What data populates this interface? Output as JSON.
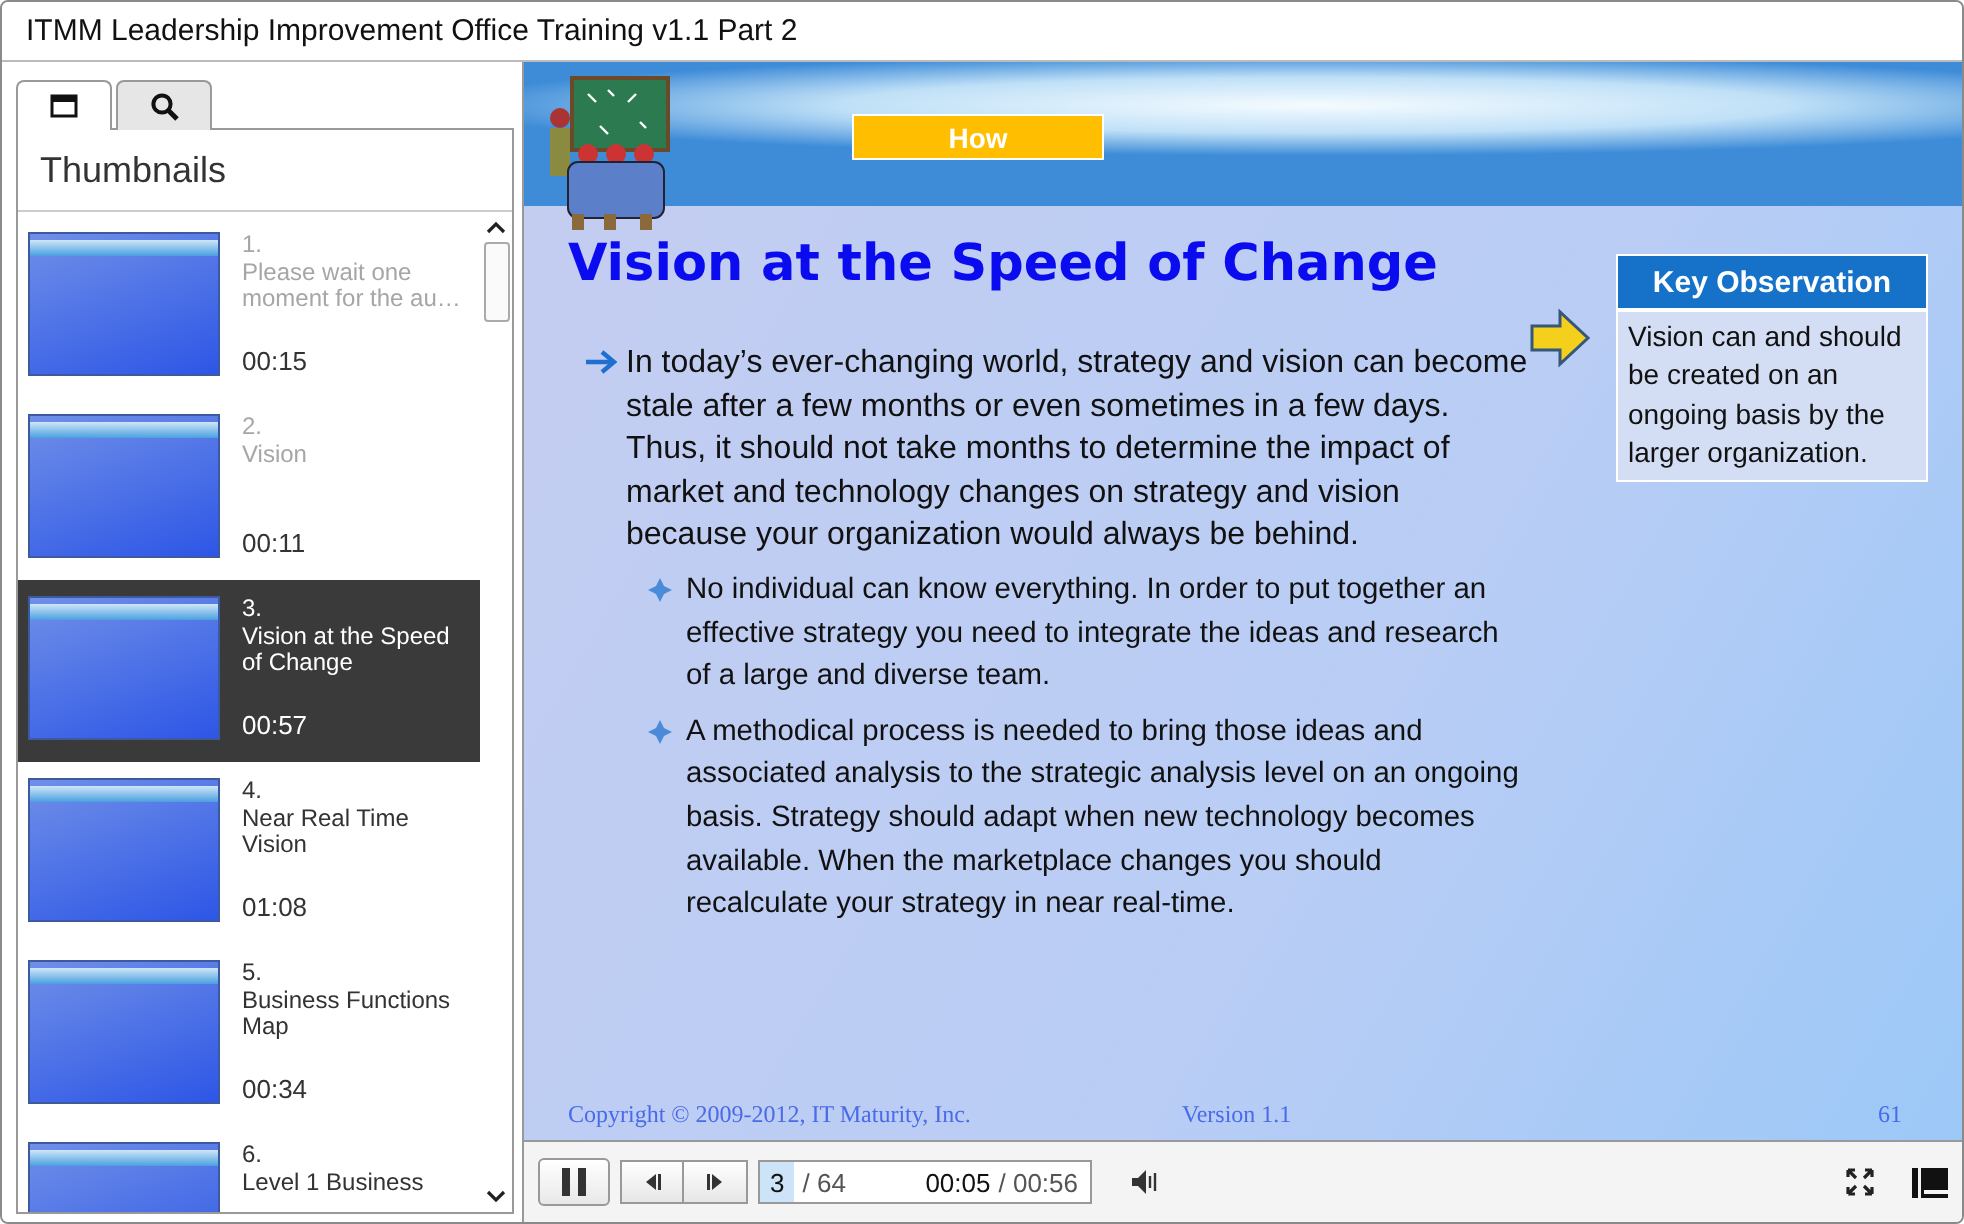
{
  "window": {
    "title": "ITMM Leadership Improvement Office Training v1.1 Part 2"
  },
  "sidebar": {
    "tabs": [
      {
        "kind": "thumbnails",
        "selected": true
      },
      {
        "kind": "search",
        "selected": false
      }
    ],
    "heading": "Thumbnails",
    "items": [
      {
        "number": "1.",
        "title": "Please wait one moment for the au…",
        "duration": "00:15",
        "visited": true,
        "selected": false
      },
      {
        "number": "2.",
        "title": "Vision",
        "duration": "00:11",
        "visited": true,
        "selected": false
      },
      {
        "number": "3.",
        "title": "Vision at the Speed of Change",
        "duration": "00:57",
        "visited": false,
        "selected": true
      },
      {
        "number": "4.",
        "title": "Near Real Time Vision",
        "duration": "01:08",
        "visited": false,
        "selected": false
      },
      {
        "number": "5.",
        "title": "Business Functions Map",
        "duration": "00:34",
        "visited": false,
        "selected": false
      },
      {
        "number": "6.",
        "title": "Level 1 Business",
        "visited": false,
        "selected": false
      }
    ]
  },
  "slide": {
    "section": "How",
    "title": "Vision at the Speed of Change",
    "bullets": [
      {
        "text": "In today’s ever-changing world, strategy and vision can become stale after a few months or even sometimes in a few days. Thus, it should not take months to determine the impact of market and technology changes on strategy and vision because your organization would always be behind.",
        "children": [
          {
            "text": "No individual can know everything. In order to put together an effective strategy you need to integrate the ideas and research of a large and diverse team."
          },
          {
            "text": "A methodical process is needed to bring those ideas and associated analysis to the strategic analysis level on an ongoing basis. Strategy should adapt when new technology becomes available. When the marketplace changes you should recalculate your strategy in near real-time."
          }
        ]
      }
    ],
    "callout": {
      "heading": "Key Observation",
      "text": "Vision can and should be created on an ongoing basis by the larger organization."
    },
    "footer": {
      "copyright": "Copyright © 2009-2012, IT Maturity, Inc.",
      "version": "Version 1.1",
      "page": "61"
    }
  },
  "player": {
    "playing": true,
    "slide_current": "3",
    "slide_total": "/ 64",
    "time_elapsed": "00:05",
    "time_total": "/ 00:56"
  }
}
